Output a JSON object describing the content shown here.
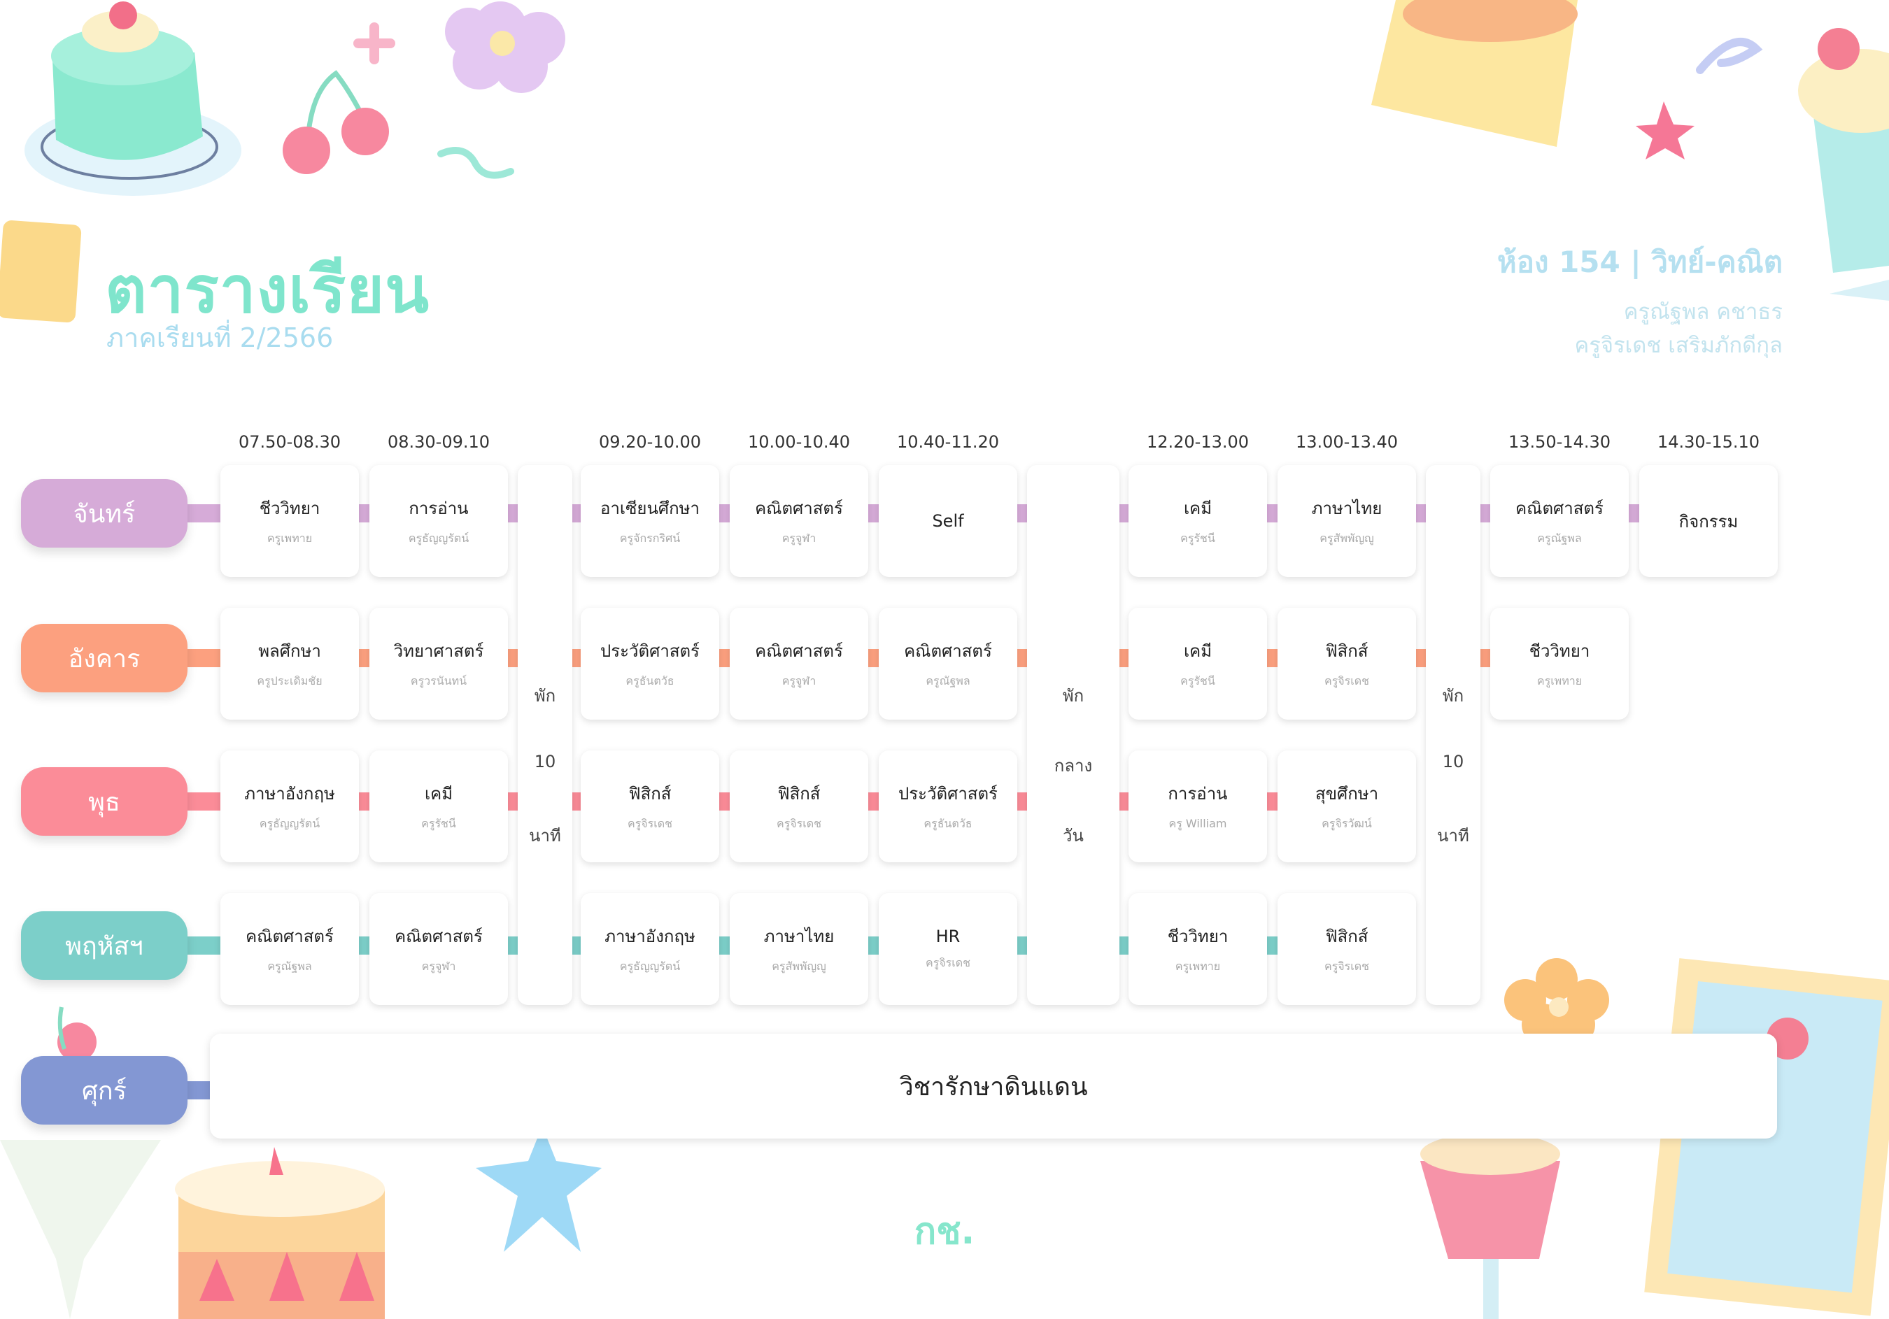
{
  "header": {
    "title": "ตารางเรียน",
    "semester": "ภาคเรียนที่ 2/2566",
    "room": "ห้อง 154 | วิทย์-คณิต",
    "teachers": [
      "ครูณัฐพล คชาธร",
      "ครูจิรเดช เสริมภักดีกุล"
    ]
  },
  "times": [
    "07.50-08.30",
    "08.30-09.10",
    "09.20-10.00",
    "10.00-10.40",
    "10.40-11.20",
    "12.20-13.00",
    "13.00-13.40",
    "13.50-14.30",
    "14.30-15.10"
  ],
  "days": [
    {
      "name": "จันทร์",
      "color": "#d6abd8"
    },
    {
      "name": "อังคาร",
      "color": "#fca07f"
    },
    {
      "name": "พุธ",
      "color": "#fb8c98"
    },
    {
      "name": "พฤหัสฯ",
      "color": "#7ccfc9"
    },
    {
      "name": "ศุกร์",
      "color": "#8397d3"
    }
  ],
  "schedule": [
    [
      {
        "subject": "ชีววิทยา",
        "teacher": "ครูเพทาย"
      },
      {
        "subject": "การอ่าน",
        "teacher": "ครูธัญญรัตน์"
      },
      {
        "subject": "อาเซียนศึกษา",
        "teacher": "ครูจักรกริศน์"
      },
      {
        "subject": "คณิตศาสตร์",
        "teacher": "ครูจูฬา"
      },
      {
        "subject": "Self",
        "teacher": ""
      },
      {
        "subject": "เคมี",
        "teacher": "ครูรัชนี"
      },
      {
        "subject": "ภาษาไทย",
        "teacher": "ครูสัพพัญญู"
      },
      {
        "subject": "คณิตศาสตร์",
        "teacher": "ครูณัฐพล"
      },
      {
        "subject": "กิจกรรม",
        "teacher": ""
      }
    ],
    [
      {
        "subject": "พลศึกษา",
        "teacher": "ครูประเดิมชัย"
      },
      {
        "subject": "วิทยาศาสตร์",
        "teacher": "ครูวรนันทน์"
      },
      {
        "subject": "ประวัติศาสตร์",
        "teacher": "ครูธันตวัธ"
      },
      {
        "subject": "คณิตศาสตร์",
        "teacher": "ครูจูฬา"
      },
      {
        "subject": "คณิตศาสตร์",
        "teacher": "ครูณัฐพล"
      },
      {
        "subject": "เคมี",
        "teacher": "ครูรัชนี"
      },
      {
        "subject": "ฟิสิกส์",
        "teacher": "ครูจิรเดช"
      },
      {
        "subject": "ชีววิทยา",
        "teacher": "ครูเพทาย"
      }
    ],
    [
      {
        "subject": "ภาษาอังกฤษ",
        "teacher": "ครูธัญญรัตน์"
      },
      {
        "subject": "เคมี",
        "teacher": "ครูรัชนี"
      },
      {
        "subject": "ฟิสิกส์",
        "teacher": "ครูจิรเดช"
      },
      {
        "subject": "ฟิสิกส์",
        "teacher": "ครูจิรเดช"
      },
      {
        "subject": "ประวัติศาสตร์",
        "teacher": "ครูธันตวัธ"
      },
      {
        "subject": "การอ่าน",
        "teacher": "ครู William"
      },
      {
        "subject": "สุขศึกษา",
        "teacher": "ครูจิรวัฒน์"
      }
    ],
    [
      {
        "subject": "คณิตศาสตร์",
        "teacher": "ครูณัฐพล"
      },
      {
        "subject": "คณิตศาสตร์",
        "teacher": "ครูจูฬา"
      },
      {
        "subject": "ภาษาอังกฤษ",
        "teacher": "ครูธัญญรัตน์"
      },
      {
        "subject": "ภาษาไทย",
        "teacher": "ครูสัพพัญญู"
      },
      {
        "subject": "HR",
        "teacher": "ครูจิรเดช"
      },
      {
        "subject": "ชีววิทยา",
        "teacher": "ครูเพทาย"
      },
      {
        "subject": "ฟิสิกส์",
        "teacher": "ครูจิรเดช"
      }
    ]
  ],
  "breaks": [
    {
      "lines": [
        "พัก",
        "10",
        "นาที"
      ]
    },
    {
      "lines": [
        "พัก",
        "กลาง",
        "วัน"
      ]
    },
    {
      "lines": [
        "พัก",
        "10",
        "นาที"
      ]
    }
  ],
  "friday_subject": "วิชารักษาดินแดน",
  "footer": "กช."
}
